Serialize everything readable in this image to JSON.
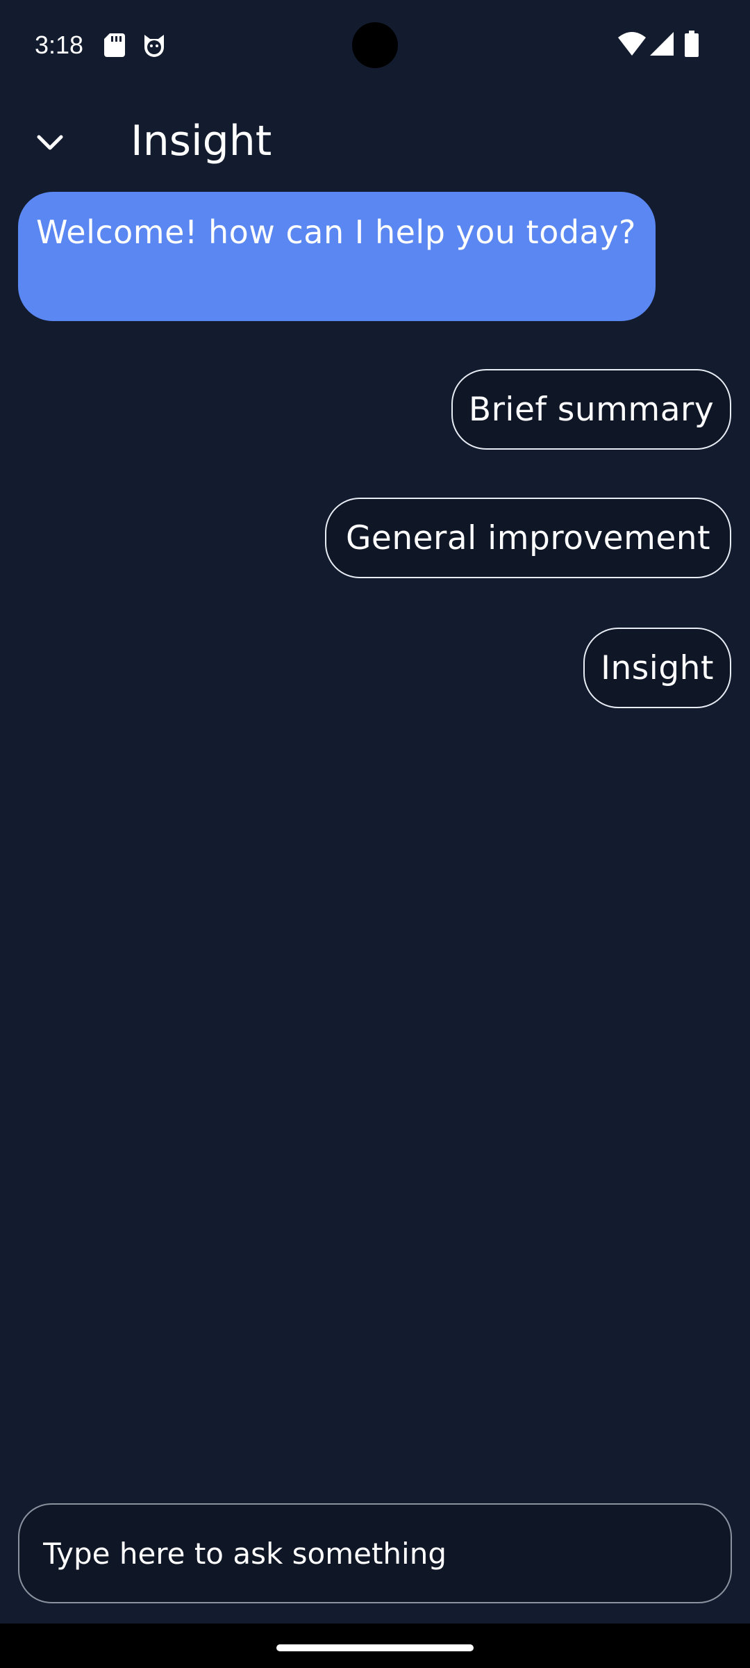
{
  "status_bar": {
    "time": "3:18",
    "icons": [
      "sd-card-icon",
      "cat-face-icon",
      "wifi-icon",
      "signal-icon",
      "battery-icon"
    ]
  },
  "app_bar": {
    "title": "Insight",
    "back_icon": "chevron-down-icon"
  },
  "chat": {
    "welcome_message": "Welcome! how can I help you today?",
    "suggestions": [
      {
        "label": "Brief summary"
      },
      {
        "label": "General improvement"
      },
      {
        "label": "Insight"
      }
    ]
  },
  "input": {
    "placeholder": "Type here to ask something",
    "value": ""
  },
  "colors": {
    "background": "#131c2e",
    "bot_bubble": "#5b87f2",
    "chip_background": "#0f1626",
    "chip_border": "#e8ecf4"
  }
}
